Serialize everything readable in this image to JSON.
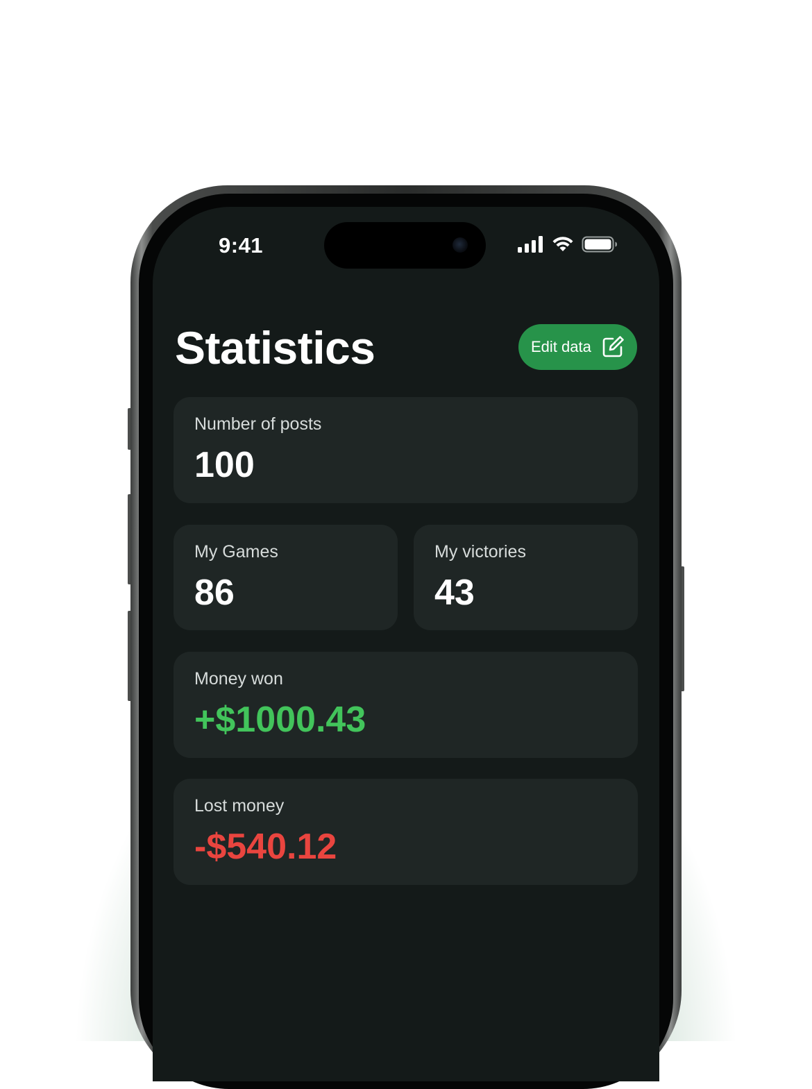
{
  "status_bar": {
    "time": "9:41"
  },
  "header": {
    "title": "Statistics",
    "edit_button_label": "Edit data"
  },
  "stats": {
    "posts": {
      "label": "Number of posts",
      "value": "100"
    },
    "games": {
      "label": "My Games",
      "value": "86"
    },
    "victories": {
      "label": "My victories",
      "value": "43"
    },
    "money_won": {
      "label": "Money won",
      "value": "+$1000.43"
    },
    "money_lost": {
      "label": "Lost money",
      "value": "-$540.12"
    }
  },
  "colors": {
    "accent": "#27934a",
    "positive": "#42c45b",
    "negative": "#e9453f",
    "screen_background": "#141a19",
    "card_background": "#1f2625"
  },
  "icons": {
    "edit": "edit-icon",
    "signal": "cellular-signal-icon",
    "wifi": "wifi-icon",
    "battery": "battery-icon"
  }
}
